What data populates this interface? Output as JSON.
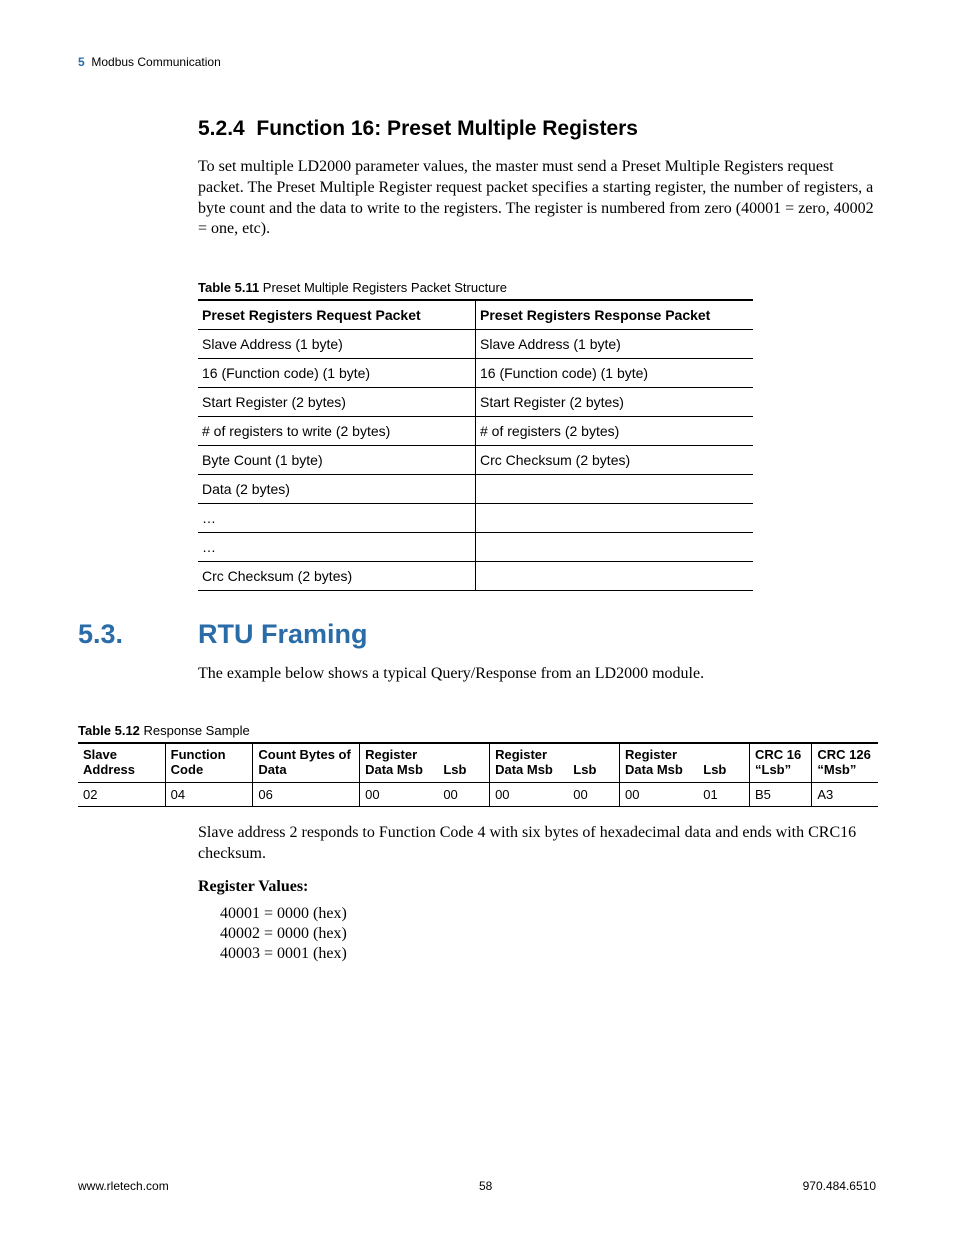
{
  "header": {
    "chapter_num": "5",
    "chapter_title": "Modbus Communication"
  },
  "section524": {
    "num": "5.2.4",
    "title": "Function 16: Preset Multiple Registers",
    "para": "To set multiple LD2000 parameter values, the master must send a Preset Multiple Registers request packet. The Preset Multiple Register request packet specifies a starting register, the number of registers, a byte count and the data to write to the registers. The register is numbered from zero (40001 = zero, 40002 = one, etc)."
  },
  "table511": {
    "caption_bold": "Table 5.11",
    "caption_rest": " Preset Multiple Registers Packet Structure",
    "h1": "Preset Registers Request Packet",
    "h2": "Preset Registers Response Packet",
    "rows": [
      [
        "Slave Address (1 byte)",
        "Slave Address (1 byte)"
      ],
      [
        "16 (Function code) (1 byte)",
        "16 (Function code) (1 byte)"
      ],
      [
        "Start Register (2 bytes)",
        "Start Register (2 bytes)"
      ],
      [
        "# of registers to write (2 bytes)",
        "# of registers  (2 bytes)"
      ],
      [
        "Byte Count (1 byte)",
        "Crc Checksum (2 bytes)"
      ],
      [
        "Data (2 bytes)",
        ""
      ],
      [
        "…",
        ""
      ],
      [
        "…",
        ""
      ],
      [
        "Crc Checksum (2 bytes)",
        ""
      ]
    ]
  },
  "section53": {
    "num": "5.3.",
    "title": "RTU Framing",
    "para": "The example below shows a typical Query/Response from an LD2000 module."
  },
  "table512": {
    "caption_bold": "Table 5.12",
    "caption_rest": " Response Sample",
    "headers": {
      "c0": "Slave Address",
      "c1": "Function Code",
      "c2": "Count Bytes of Data",
      "c3a": "Register Data Msb",
      "c3b": "Lsb",
      "c4a": "Register Data Msb",
      "c4b": "Lsb",
      "c5a": "Register Data Msb",
      "c5b": "Lsb",
      "c6": "CRC 16 “Lsb”",
      "c7": "CRC 126 “Msb”"
    },
    "row": [
      "02",
      "04",
      "06",
      "00",
      "00",
      "00",
      "00",
      "00",
      "01",
      "B5",
      "A3"
    ]
  },
  "after_table_para": "Slave address 2 responds to Function Code 4 with six bytes of hexadecimal data and ends with CRC16 checksum.",
  "regvals": {
    "head": "Register Values:",
    "lines": [
      "40001 = 0000 (hex)",
      "40002 = 0000 (hex)",
      "40003 = 0001 (hex)"
    ]
  },
  "footer": {
    "left": "www.rletech.com",
    "center": "58",
    "right": "970.484.6510"
  }
}
